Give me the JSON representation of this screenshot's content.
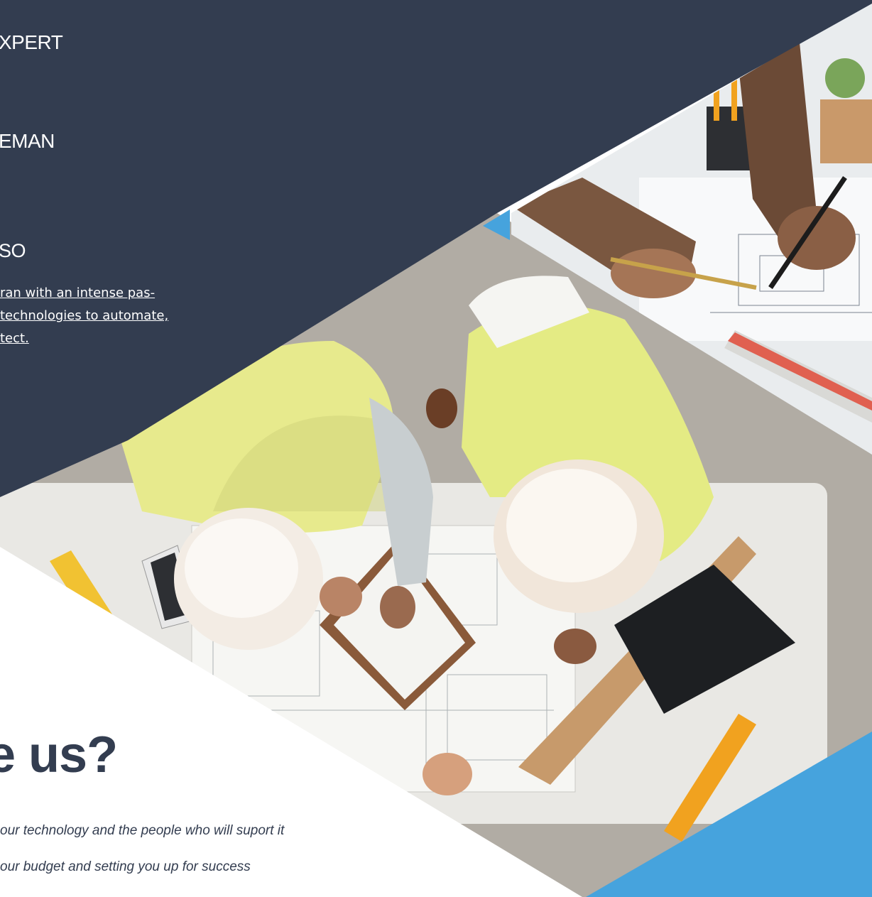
{
  "colors": {
    "navy": "#333d50",
    "blue": "#46a3dd",
    "white": "#ffffff"
  },
  "nav": {
    "expert": "XPERT",
    "foreman": "EMAN",
    "ciso": "SO"
  },
  "bio": {
    "line1": "ran with an intense pas-",
    "line2": "technologies to automate,",
    "line3": "tect."
  },
  "section": {
    "heading": "e us?",
    "bullets": [
      "our technology and the people who will suport it",
      "our budget and setting you up for success",
      "                                                    "
    ]
  },
  "images": {
    "main_photo": "construction-workers-blueprints-photo",
    "top_right_photo": "architect-hands-drawing-plans-photo"
  }
}
